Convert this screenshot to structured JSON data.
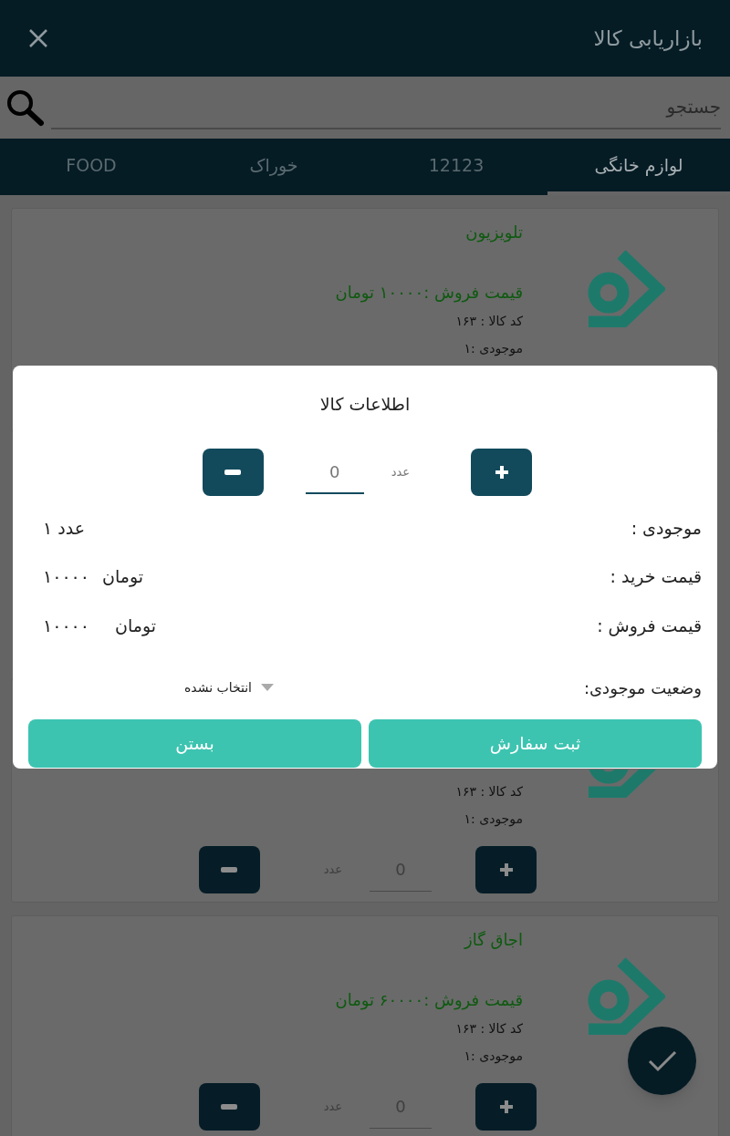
{
  "app_bar": {
    "title": "بازاریابی کالا"
  },
  "search": {
    "placeholder": "جستجو"
  },
  "tabs": [
    {
      "label": "لوازم خانگی",
      "selected": true
    },
    {
      "label": "12123",
      "selected": false
    },
    {
      "label": "خوراک",
      "selected": false
    },
    {
      "label": "FOOD",
      "selected": false
    }
  ],
  "products": [
    {
      "name": "تلویزیون",
      "price": "قیمت فروش :۱۰۰۰۰ تومان",
      "code": "کد کالا : ۱۶۳",
      "stock": "موجودی :۱"
    },
    {
      "code": "کد کالا : ۱۶۳",
      "stock": "موجودی :۱",
      "unit": "عدد",
      "quantity": "0"
    },
    {
      "name": "اجاق گاز",
      "price": "قیمت فروش :۶۰۰۰۰ تومان",
      "code": "کد کالا : ۱۶۳",
      "stock": "موجودی :۱",
      "unit": "عدد",
      "quantity": "0"
    }
  ],
  "dialog": {
    "title": "اطلاعات کالا",
    "unit": "عدد",
    "quantity": "0",
    "stock": {
      "label": "موجودی :",
      "value": "عدد ۱"
    },
    "buy_price": {
      "label": "قیمت خرید :",
      "currency": "تومان",
      "value": "۱۰۰۰۰"
    },
    "sell_price": {
      "label": "قیمت فروش :",
      "currency": "تومان",
      "value": "۱۰۰۰۰"
    },
    "status": {
      "label": "وضعیت موجودی:",
      "value": "انتخاب نشده"
    },
    "buttons": [
      "ثبت سفارش",
      "بستن"
    ]
  }
}
